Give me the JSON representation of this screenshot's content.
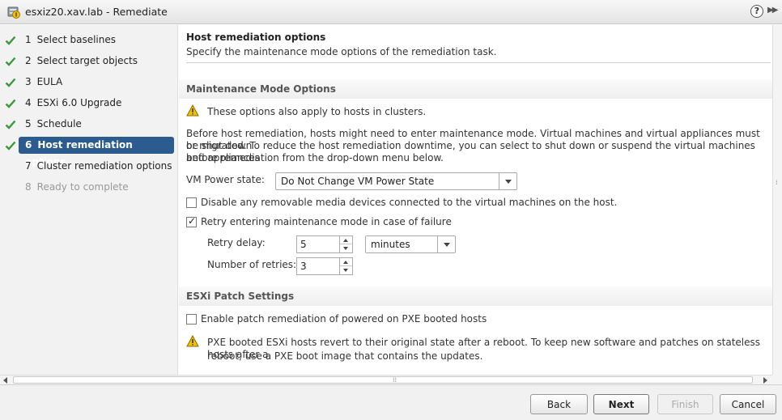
{
  "window": {
    "title": "esxiz20.xav.lab - Remediate",
    "help_label": "?",
    "expand_label": "▶▶"
  },
  "steps": [
    {
      "number": "1",
      "label": "Select baselines",
      "state": "completed"
    },
    {
      "number": "2",
      "label": "Select target objects",
      "state": "completed"
    },
    {
      "number": "3",
      "label": "EULA",
      "state": "completed"
    },
    {
      "number": "4",
      "label": "ESXi 6.0 Upgrade",
      "state": "completed"
    },
    {
      "number": "5",
      "label": "Schedule",
      "state": "completed"
    },
    {
      "number": "6",
      "label": "Host remediation options",
      "state": "active"
    },
    {
      "number": "7",
      "label": "Cluster remediation options",
      "state": "pending"
    },
    {
      "number": "8",
      "label": "Ready to complete",
      "state": "disabled"
    }
  ],
  "page": {
    "title": "Host remediation options",
    "subtitle": "Specify the maintenance mode options of the remediation task."
  },
  "maintenance": {
    "section_title": "Maintenance Mode Options",
    "cluster_warning": "These options also apply to hosts in clusters.",
    "description_lines": [
      "Before host remediation, hosts might need to enter maintenance mode. Virtual machines and virtual appliances must be shut down",
      "or migrated. To reduce the host remediation downtime, you can select to shut down or suspend the virtual machines and appliances",
      "before remediation from the drop-down menu below."
    ],
    "vm_power_label": "VM Power state:",
    "vm_power_value": "Do Not Change VM Power State",
    "disable_media_label": "Disable any removable media devices connected to the virtual machines on the host.",
    "disable_media_checked": false,
    "retry_label": "Retry entering maintenance mode in case of failure",
    "retry_checked": true,
    "retry_delay_label": "Retry delay:",
    "retry_delay_value": "5",
    "retry_delay_unit": "minutes",
    "retries_label": "Number of retries:",
    "retries_value": "3"
  },
  "patch": {
    "section_title": "ESXi Patch Settings",
    "pxe_label": "Enable patch remediation of powered on PXE booted hosts",
    "pxe_checked": false,
    "pxe_warning_lines": [
      "PXE booted ESXi hosts revert to their original state after a reboot. To keep new software and patches on stateless hosts after a",
      "reboot, use a PXE boot image that contains the updates."
    ]
  },
  "footer": {
    "back": "Back",
    "next": "Next",
    "finish": "Finish",
    "cancel": "Cancel"
  },
  "colors": {
    "active_step_bg": "#2b5b8f",
    "check_green": "#3a9a3a",
    "warning_yellow": "#f2c200"
  }
}
